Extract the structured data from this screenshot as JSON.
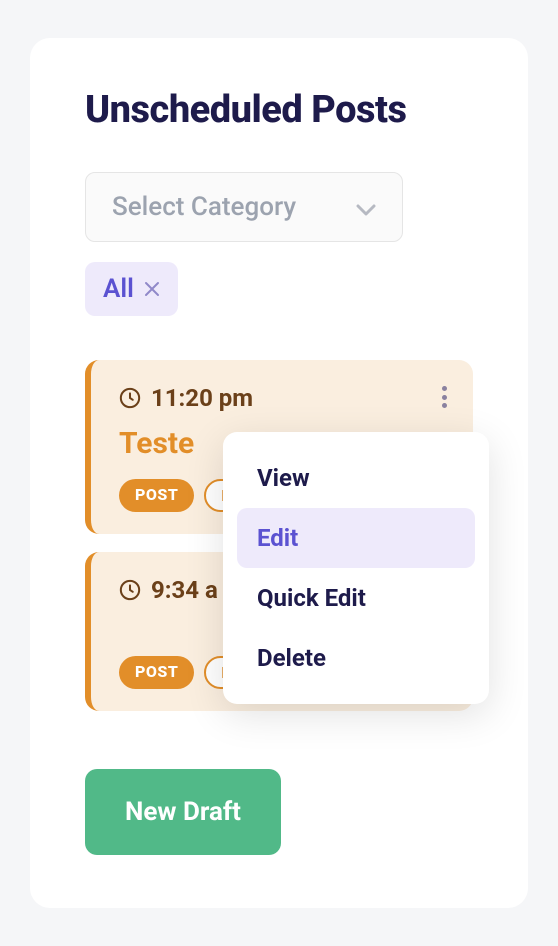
{
  "header": {
    "title": "Unscheduled Posts"
  },
  "category_select": {
    "placeholder": "Select Category"
  },
  "filter": {
    "label": "All"
  },
  "posts": [
    {
      "time": "11:20 pm",
      "title": "Teste",
      "badge_primary": "POST",
      "badge_secondary": "D"
    },
    {
      "time": "9:34 a",
      "title": "",
      "badge_primary": "POST",
      "badge_secondary": "D"
    }
  ],
  "dropdown": {
    "items": [
      {
        "label": "View",
        "active": false
      },
      {
        "label": "Edit",
        "active": true
      },
      {
        "label": "Quick Edit",
        "active": false
      },
      {
        "label": "Delete",
        "active": false
      }
    ]
  },
  "buttons": {
    "new_draft": "New Draft"
  }
}
